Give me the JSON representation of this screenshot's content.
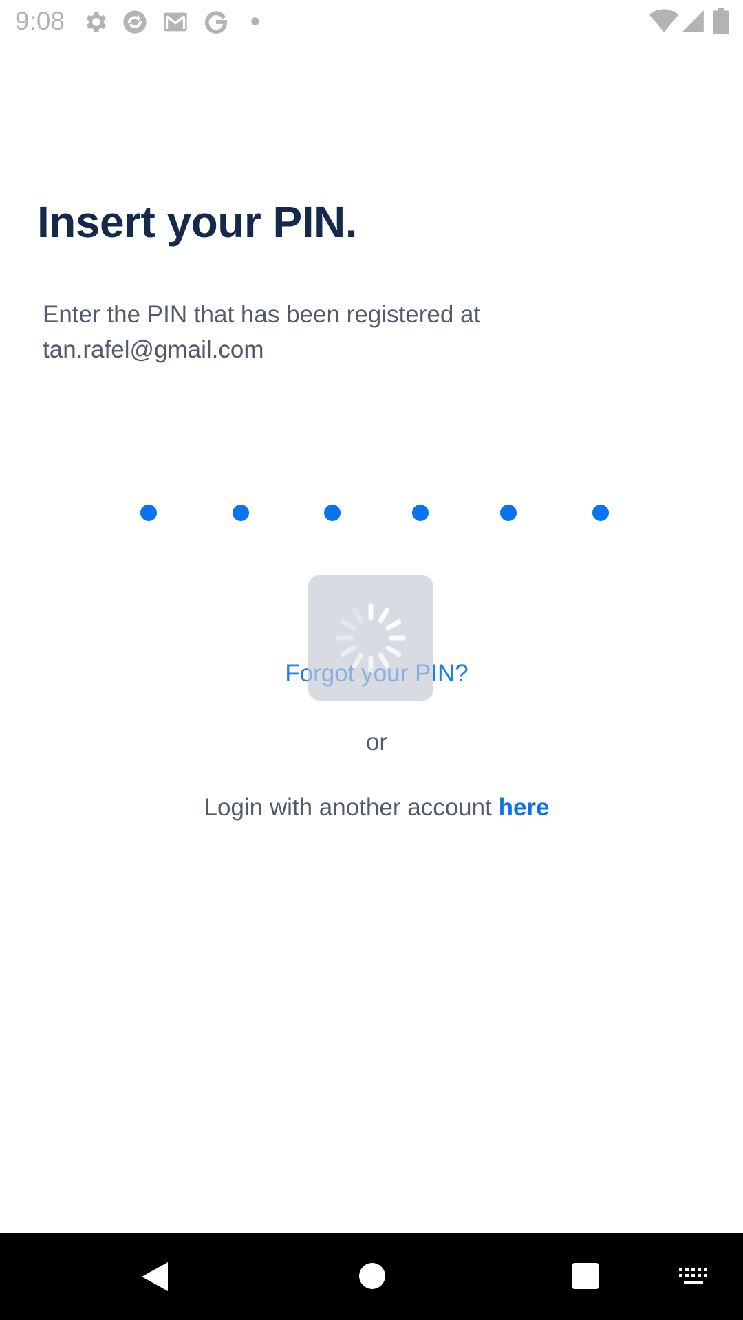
{
  "status_bar": {
    "time": "9:08",
    "notification_icons": [
      "gear-icon",
      "app-refresh-icon",
      "gmail-icon",
      "google-icon",
      "dot-icon"
    ],
    "system_icons": [
      "wifi-icon",
      "cell-signal-icon",
      "battery-icon"
    ],
    "icon_color": "#b3b3b3"
  },
  "screen": {
    "title": "Insert your PIN.",
    "subtitle_line1": "Enter the PIN that has been registered at",
    "email": "tan.rafel@gmail.com",
    "pin_length": 6,
    "pin_filled": 6,
    "forgot_link": "Forgot your PIN?",
    "or_text": "or",
    "login_text": "Login with another account",
    "login_link": "here",
    "loading": true
  },
  "colors": {
    "title": "#15294a",
    "body_text": "#535a6b",
    "accent": "#0a74f0",
    "spinner_bg": "#c3cad2"
  },
  "nav_bar": {
    "buttons": [
      "back-icon",
      "home-icon",
      "recents-icon",
      "keyboard-icon"
    ]
  }
}
